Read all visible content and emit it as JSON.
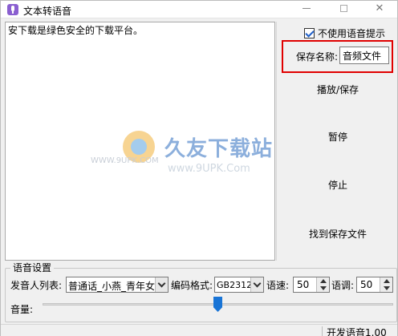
{
  "window": {
    "title": "文本转语音",
    "minimize_icon": "minimize-icon",
    "maximize_icon": "maximize-icon",
    "close_glyph": "✕"
  },
  "editor": {
    "text": "安下载是绿色安全的下载平台。"
  },
  "watermark": {
    "brand": "久友下载站",
    "url_small": "WWW.9UPK.COM",
    "url_large": "www.9UPK.Com"
  },
  "options": {
    "no_voice_hint_label": "不使用语音提示",
    "no_voice_hint_checked": true
  },
  "save": {
    "name_label": "保存名称:",
    "name_value": "音频文件",
    "highlight_color": "#e00000"
  },
  "actions": {
    "play_save": "播放/保存",
    "pause": "暂停",
    "stop": "停止",
    "find_saved": "找到保存文件"
  },
  "voice_settings": {
    "group_title": "语音设置",
    "speaker_label": "发音人列表:",
    "speaker_value": "普通话_小燕_青年女",
    "encoding_label": "编码格式:",
    "encoding_value": "GB2312",
    "speed_label": "语速:",
    "speed_value": "50",
    "pitch_label": "语调:",
    "pitch_value": "50",
    "volume_label": "音量:",
    "volume_level_fraction": 0.5
  },
  "status": {
    "text": "开发语音1.00"
  },
  "colors": {
    "accent": "#1874d6",
    "watermark_brand": "#2f6fc0"
  }
}
